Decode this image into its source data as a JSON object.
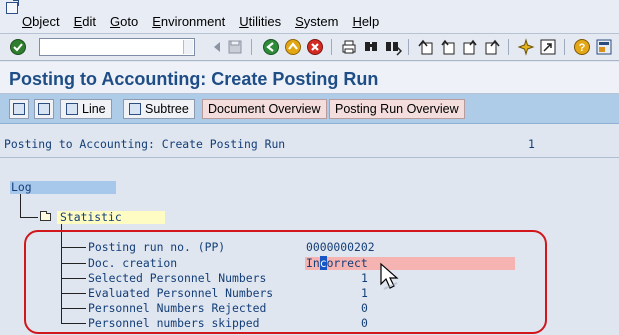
{
  "menu": {
    "items": [
      "Object",
      "Edit",
      "Goto",
      "Environment",
      "Utilities",
      "System",
      "Help"
    ]
  },
  "toolbar": {
    "command_field_value": "",
    "icons": [
      "enter-icon",
      "back-icon",
      "exit-icon",
      "cancel-icon",
      "print-icon",
      "find-icon",
      "find-next-icon",
      "first-page-icon",
      "previous-page-icon",
      "next-page-icon",
      "last-page-icon",
      "create-session-icon",
      "shortcut-icon",
      "help-icon",
      "customize-layout-icon"
    ]
  },
  "title": "Posting to Accounting: Create Posting Run",
  "app_toolbar": {
    "line_label": "Line",
    "subtree_label": "Subtree",
    "document_overview_label": "Document Overview",
    "posting_run_overview_label": "Posting Run Overview"
  },
  "list": {
    "heading": "Posting to Accounting: Create Posting Run",
    "count": "1",
    "log_label": "Log",
    "statistic_label": "Statistic",
    "rows": [
      {
        "label": "Posting run no. (PP)",
        "value": "0000000202"
      },
      {
        "label": "Doc. creation",
        "value_before": "In",
        "value_cursor": "c",
        "value_after": "orrect"
      },
      {
        "label": "Selected Personnel Numbers",
        "value": "1"
      },
      {
        "label": "Evaluated Personnel Numbers",
        "value": "1"
      },
      {
        "label": "Personnel Numbers Rejected",
        "value": "0"
      },
      {
        "label": "Personnel numbers skipped",
        "value": "0"
      }
    ]
  },
  "colors": {
    "title": "#1f4d86",
    "app_toolbar": "#aecbe8",
    "highlight": "#d1171c",
    "incorrect_bg": "#f5b3b1"
  }
}
